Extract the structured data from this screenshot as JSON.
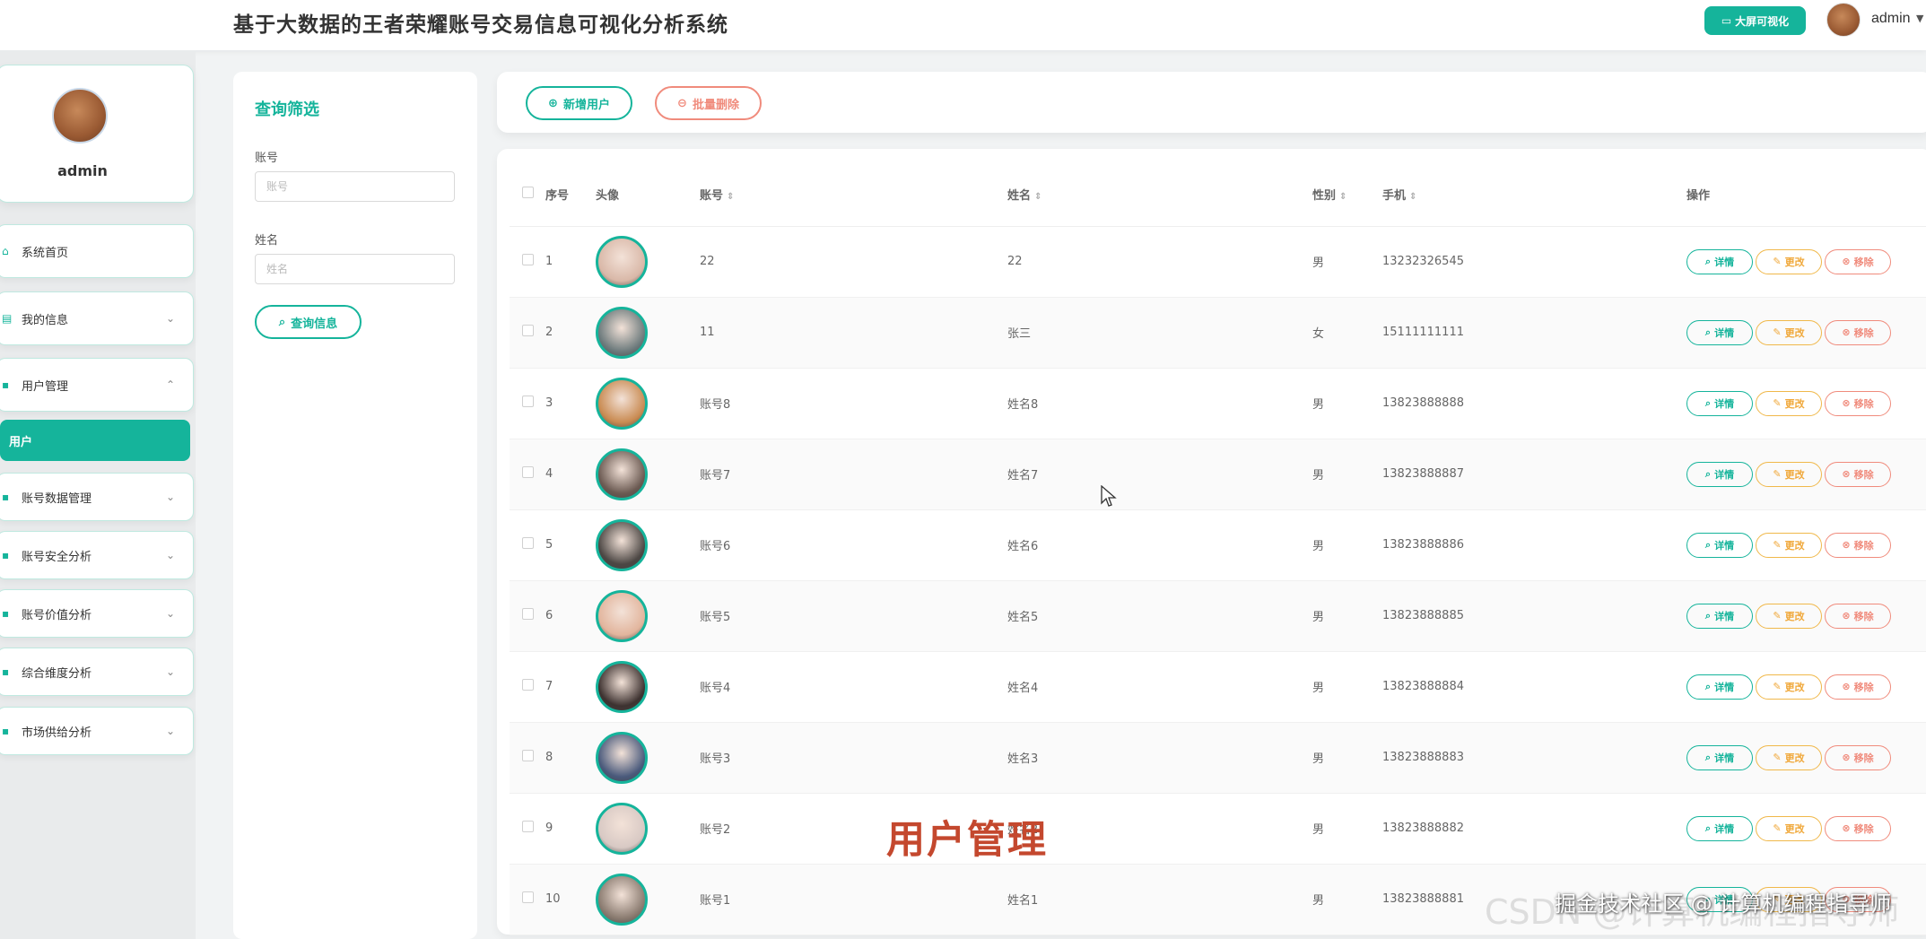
{
  "header": {
    "title": "基于大数据的王者荣耀账号交易信息可视化分析系统",
    "bigscreen_label": "大屏可视化",
    "username": "admin"
  },
  "sidebar": {
    "profile_name": "admin",
    "items": [
      {
        "label": "系统首页"
      },
      {
        "label": "我的信息"
      },
      {
        "label": "用户管理"
      },
      {
        "label": "用户"
      },
      {
        "label": "账号数据管理"
      },
      {
        "label": "账号安全分析"
      },
      {
        "label": "账号价值分析"
      },
      {
        "label": "综合维度分析"
      },
      {
        "label": "市场供给分析"
      }
    ]
  },
  "filter": {
    "title": "查询筛选",
    "account_label": "账号",
    "account_placeholder": "账号",
    "name_label": "姓名",
    "name_placeholder": "姓名",
    "search_label": "查询信息"
  },
  "actions": {
    "add_label": "新增用户",
    "batch_delete_label": "批量删除"
  },
  "table": {
    "headers": {
      "index": "序号",
      "avatar": "头像",
      "account": "账号",
      "name": "姓名",
      "gender": "性别",
      "phone": "手机",
      "ops": "操作"
    },
    "ops": {
      "detail": "详情",
      "edit": "更改",
      "remove": "移除"
    },
    "rows": [
      {
        "index": "1",
        "account": "22",
        "name": "22",
        "gender": "男",
        "phone": "13232326545",
        "avatar_color": "#d9b8a8"
      },
      {
        "index": "2",
        "account": "11",
        "name": "张三",
        "gender": "女",
        "phone": "15111111111",
        "avatar_color": "#6c7a7c"
      },
      {
        "index": "3",
        "account": "账号8",
        "name": "姓名8",
        "gender": "男",
        "phone": "13823888888",
        "avatar_color": "#c98b52"
      },
      {
        "index": "4",
        "account": "账号7",
        "name": "姓名7",
        "gender": "男",
        "phone": "13823888887",
        "avatar_color": "#6b5a52"
      },
      {
        "index": "5",
        "account": "账号6",
        "name": "姓名6",
        "gender": "男",
        "phone": "13823888886",
        "avatar_color": "#4c4744"
      },
      {
        "index": "6",
        "account": "账号5",
        "name": "姓名5",
        "gender": "男",
        "phone": "13823888885",
        "avatar_color": "#e2b59d"
      },
      {
        "index": "7",
        "account": "账号4",
        "name": "姓名4",
        "gender": "男",
        "phone": "13823888884",
        "avatar_color": "#3d3230"
      },
      {
        "index": "8",
        "account": "账号3",
        "name": "姓名3",
        "gender": "男",
        "phone": "13823888883",
        "avatar_color": "#4a5a7c"
      },
      {
        "index": "9",
        "account": "账号2",
        "name": "姓名2",
        "gender": "男",
        "phone": "13823888882",
        "avatar_color": "#d8c9c4"
      },
      {
        "index": "10",
        "account": "账号1",
        "name": "姓名1",
        "gender": "男",
        "phone": "13823888881",
        "avatar_color": "#8a7b70"
      }
    ]
  },
  "overlay": {
    "caption": "用户管理",
    "watermark": "CSDN @计算机编程指导师",
    "watermark_overlay": "掘金技术社区 @ 计算机编程指导师"
  },
  "colors": {
    "accent": "#15b49b",
    "warning": "#f0a83a",
    "danger": "#f08b7c"
  }
}
